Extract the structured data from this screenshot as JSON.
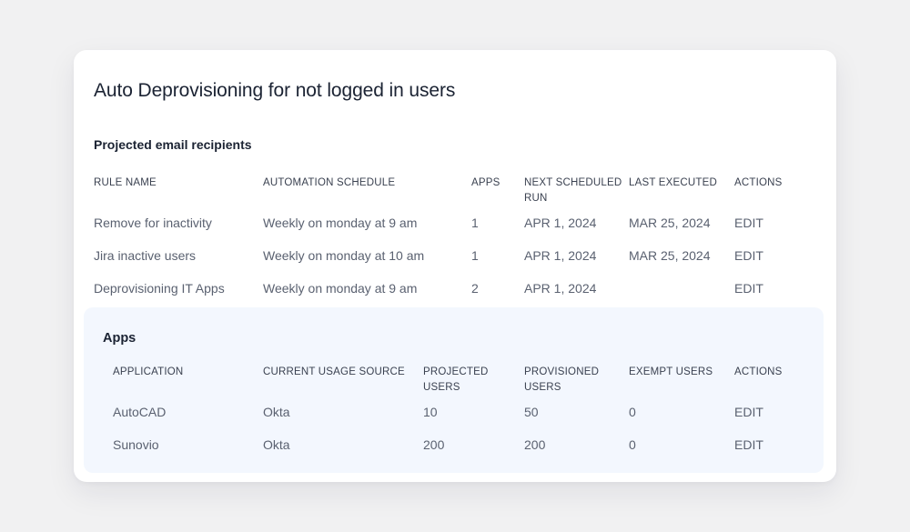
{
  "card": {
    "title": "Auto Deprovisioning for not logged in users",
    "subtitle": "Projected email recipients"
  },
  "rules_table": {
    "headers": {
      "rule_name": "RULE NAME",
      "schedule": "AUTOMATION SCHEDULE",
      "apps": "APPS",
      "next_run": "NEXT SCHEDULED RUN",
      "last_executed": "LAST EXECUTED",
      "actions": "ACTIONS"
    },
    "rows": [
      {
        "rule_name": "Remove for inactivity",
        "schedule": "Weekly on monday at 9 am",
        "apps": "1",
        "next_run": "APR 1, 2024",
        "last_executed": "MAR 25, 2024",
        "action": "EDIT"
      },
      {
        "rule_name": "Jira inactive users",
        "schedule": "Weekly on monday at 10 am",
        "apps": "1",
        "next_run": "APR 1, 2024",
        "last_executed": "MAR 25, 2024",
        "action": "EDIT"
      },
      {
        "rule_name": "Deprovisioning IT Apps",
        "schedule": "Weekly on monday at 9 am",
        "apps": "2",
        "next_run": "APR 1, 2024",
        "last_executed": "",
        "action": "EDIT"
      }
    ]
  },
  "apps_panel": {
    "title": "Apps",
    "headers": {
      "application": "APPLICATION",
      "usage_source": "CURRENT USAGE SOURCE",
      "projected": "PROJECTED USERS",
      "provisioned": "PROVISIONED USERS",
      "exempt": "EXEMPT USERS",
      "actions": "ACTIONS"
    },
    "rows": [
      {
        "application": "AutoCAD",
        "usage_source": "Okta",
        "projected": "10",
        "provisioned": "50",
        "exempt": "0",
        "action": "EDIT"
      },
      {
        "application": "Sunovio",
        "usage_source": "Okta",
        "projected": "200",
        "provisioned": "200",
        "exempt": "0",
        "action": "EDIT"
      }
    ]
  }
}
